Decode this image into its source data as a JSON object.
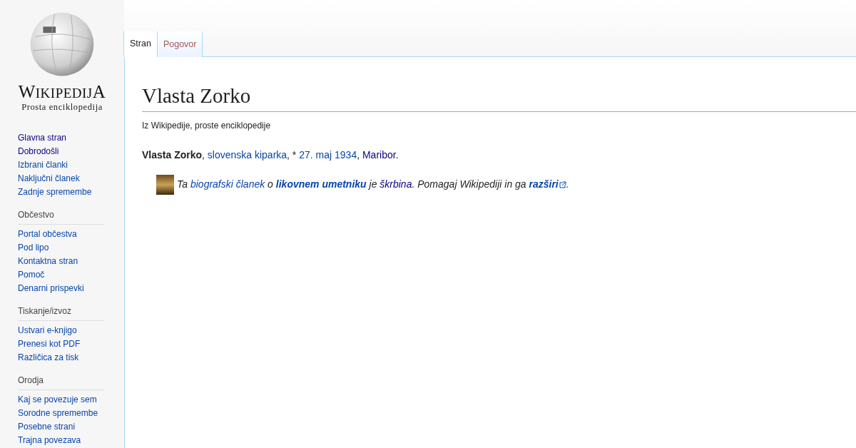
{
  "logo": {
    "wordmark": "WIKIPEDIJA",
    "tagline": "Prosta enciklopedija"
  },
  "sidebar": {
    "sections": [
      {
        "items": [
          {
            "label": "Glavna stran",
            "visited": true
          },
          {
            "label": "Dobrodošli",
            "visited": true
          },
          {
            "label": "Izbrani članki",
            "visited": false
          },
          {
            "label": "Naključni članek",
            "visited": false
          },
          {
            "label": "Zadnje spremembe",
            "visited": false
          }
        ]
      },
      {
        "heading": "Občestvo",
        "items": [
          {
            "label": "Portal občestva",
            "visited": false
          },
          {
            "label": "Pod lipo",
            "visited": false
          },
          {
            "label": "Kontaktna stran",
            "visited": false
          },
          {
            "label": "Pomoč",
            "visited": false
          },
          {
            "label": "Denarni prispevki",
            "visited": false
          }
        ]
      },
      {
        "heading": "Tiskanje/izvoz",
        "items": [
          {
            "label": "Ustvari e-knjigo",
            "visited": false
          },
          {
            "label": "Prenesi kot PDF",
            "visited": false
          },
          {
            "label": "Različica za tisk",
            "visited": false
          }
        ]
      },
      {
        "heading": "Orodja",
        "items": [
          {
            "label": "Kaj se povezuje sem",
            "visited": false
          },
          {
            "label": "Sorodne spremembe",
            "visited": false
          },
          {
            "label": "Posebne strani",
            "visited": false
          },
          {
            "label": "Trajna povezava",
            "visited": false
          }
        ]
      }
    ]
  },
  "tabs": [
    {
      "label": "Stran",
      "selected": true
    },
    {
      "label": "Pogovor",
      "selected": false
    }
  ],
  "article": {
    "title": "Vlasta Zorko",
    "subtitle": "Iz Wikipedije, proste enciklopedije",
    "lead": [
      {
        "kind": "bold",
        "text": "Vlasta Zorko"
      },
      {
        "kind": "plain",
        "text": ", "
      },
      {
        "kind": "link",
        "text": "slovenska kiparka"
      },
      {
        "kind": "plain",
        "text": ", * "
      },
      {
        "kind": "link",
        "text": "27. maj 1934"
      },
      {
        "kind": "plain",
        "text": ", "
      },
      {
        "kind": "visited",
        "text": "Maribor"
      },
      {
        "kind": "plain",
        "text": "."
      }
    ],
    "stub": [
      {
        "kind": "plain",
        "text": "Ta "
      },
      {
        "kind": "link",
        "text": "biografski članek"
      },
      {
        "kind": "plain",
        "text": " o "
      },
      {
        "kind": "boldlink",
        "text": "likovnem umetniku"
      },
      {
        "kind": "plain",
        "text": " je "
      },
      {
        "kind": "visited",
        "text": "škrbina"
      },
      {
        "kind": "plain",
        "text": ". Pomagaj Wikipediji in ga "
      },
      {
        "kind": "external",
        "text": "razširi"
      },
      {
        "kind": "plain",
        "text": "."
      }
    ]
  }
}
